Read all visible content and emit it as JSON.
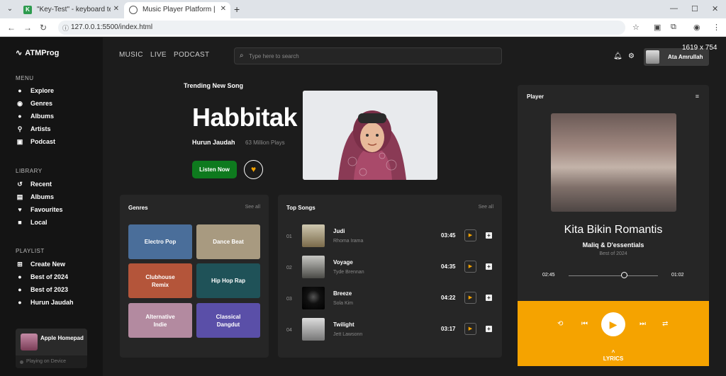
{
  "browser": {
    "tabs": [
      {
        "label": "\"Key-Test\" - keyboard test onlin",
        "favicon": "K"
      },
      {
        "label": "Music Player Platform | ATMProg",
        "favicon": ""
      }
    ],
    "url": "127.0.0.1:5500/index.html",
    "dims": "1619 x 754"
  },
  "sidebar": {
    "logo": "ATMProg",
    "menu_title": "MENU",
    "menu": [
      {
        "label": "Explore",
        "icon": "play-circle-icon"
      },
      {
        "label": "Genres",
        "icon": "disc-icon"
      },
      {
        "label": "Albums",
        "icon": "album-icon"
      },
      {
        "label": "Artists",
        "icon": "microphone-icon"
      },
      {
        "label": "Podcast",
        "icon": "podcast-icon"
      }
    ],
    "library_title": "LIBRARY",
    "library": [
      {
        "label": "Recent",
        "icon": "history-icon"
      },
      {
        "label": "Albums",
        "icon": "album-icon"
      },
      {
        "label": "Favourites",
        "icon": "heart-icon"
      },
      {
        "label": "Local",
        "icon": "folder-icon"
      }
    ],
    "playlist_title": "PLAYLIST",
    "playlist": [
      {
        "label": "Create New",
        "icon": "plus-icon"
      },
      {
        "label": "Best of 2024",
        "icon": "play-circle-icon"
      },
      {
        "label": "Best of 2023",
        "icon": "play-circle-icon"
      },
      {
        "label": "Hurun Jaudah",
        "icon": "play-circle-icon"
      }
    ],
    "device": {
      "name": "Apple Homepad",
      "status": "Playing on Device"
    }
  },
  "header": {
    "nav": [
      "MUSIC",
      "LIVE",
      "PODCAST"
    ],
    "search_placeholder": "Type here to search",
    "user": "Ata Amrullah"
  },
  "hero": {
    "label": "Trending New Song",
    "title": "Habbitak",
    "artist": "Hurun Jaudah",
    "plays": "63 Million Plays",
    "listen": "Listen Now"
  },
  "genres": {
    "title": "Genres",
    "see_all": "See all",
    "items": [
      {
        "label": "Electro Pop",
        "color": "#4a6e9a"
      },
      {
        "label": "Dance Beat",
        "color": "#a89a80"
      },
      {
        "label": "Clubhouse Remix",
        "color": "#b4553a"
      },
      {
        "label": "Hip Hop Rap",
        "color": "#1f5258"
      },
      {
        "label": "Alternative Indie",
        "color": "#b38aa0"
      },
      {
        "label": "Classical Dangdut",
        "color": "#5a4fa8"
      }
    ]
  },
  "top_songs": {
    "title": "Top Songs",
    "see_all": "See all",
    "items": [
      {
        "num": "01",
        "title": "Judi",
        "artist": "Rhoma Irama",
        "duration": "03:45"
      },
      {
        "num": "02",
        "title": "Voyage",
        "artist": "Tyde Brennan",
        "duration": "04:35"
      },
      {
        "num": "03",
        "title": "Breeze",
        "artist": "Sola Kim",
        "duration": "04:22"
      },
      {
        "num": "04",
        "title": "Twilight",
        "artist": "Jett Lawsonn",
        "duration": "03:17"
      }
    ]
  },
  "player": {
    "title": "Player",
    "song": "Kita Bikin Romantis",
    "artist": "Maliq & D'essentials",
    "album": "Best of 2024",
    "current": "02:45",
    "remaining": "01:02",
    "progress": 0.63,
    "lyrics": "LYRICS",
    "accent": "#f5a300"
  }
}
